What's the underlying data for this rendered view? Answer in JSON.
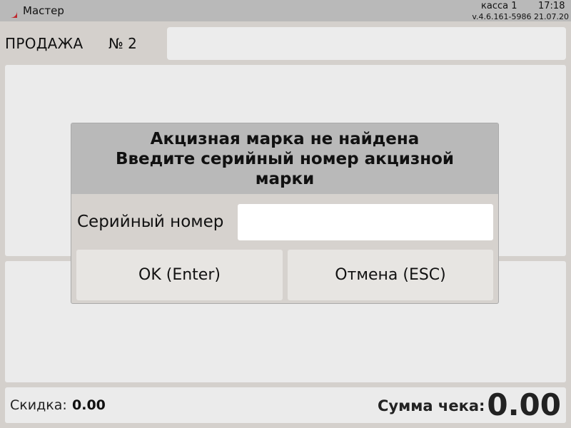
{
  "titlebar": {
    "app_name": "Мастер",
    "kassa": "касса 1",
    "time": "17:18",
    "version": "v.4.6.161-5986  21.07.20",
    "logo_color": "#c0272d"
  },
  "sale": {
    "label": "ПРОДАЖА",
    "number": "№ 2"
  },
  "footer": {
    "discount_label": "Скидка:",
    "discount_value": "0.00",
    "total_label": "Сумма чека:",
    "total_value": "0.00"
  },
  "dialog": {
    "title_line1": "Акцизная марка не найдена",
    "title_line2": "Введите серийный номер акцизной",
    "title_line3": "марки",
    "serial_label": "Серийный номер",
    "serial_value": "",
    "ok_label": "OK (Enter)",
    "cancel_label": "Отмена (ESC)"
  }
}
